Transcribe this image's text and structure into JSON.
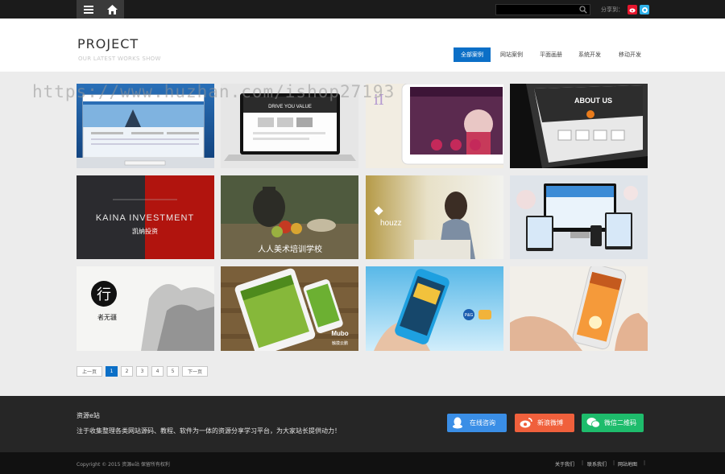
{
  "topbar": {
    "menu_icon": "menu-icon",
    "home_icon": "home-icon",
    "search_value": "",
    "search_icon": "search-icon",
    "share_label": "分享到：",
    "share_weibo_icon": "weibo-icon",
    "share_qzone_icon": "qzone-icon"
  },
  "header": {
    "title": "PROJECT",
    "subtitle": "OUR LATEST WORKS SHOW",
    "nav": [
      "全部案例",
      "网站案例",
      "平面画册",
      "系统开发",
      "移动开发"
    ],
    "active_nav": "全部案例"
  },
  "watermark": "https://www.huzhan.com/ishop27193",
  "gallery": {
    "tiles": [
      {
        "label": "",
        "theme": "blue-website-monitor"
      },
      {
        "label": "DRIVE YOU VALUE",
        "theme": "laptop-mockup"
      },
      {
        "label": "",
        "theme": "purple-tablet"
      },
      {
        "label": "ABOUT US",
        "theme": "dark-tablet"
      },
      {
        "label": "KAINA INVESTMENT",
        "sublabel": "凯纳投资",
        "theme": "red-grey-brand"
      },
      {
        "label": "人人美术培训学校",
        "theme": "still-life-painting"
      },
      {
        "label": "houzz",
        "theme": "woman-reading"
      },
      {
        "label": "",
        "theme": "responsive-devices"
      },
      {
        "label": "行",
        "sublabel": "者无疆",
        "theme": "ink-mountains"
      },
      {
        "label": "Mubo",
        "sublabel": "触摸云鹏",
        "theme": "tablet-phone-wood"
      },
      {
        "label": "P&G",
        "theme": "hand-phone-sky"
      },
      {
        "label": "",
        "theme": "hand-iphone-orange"
      }
    ]
  },
  "pagination": {
    "prev": "上一页",
    "pages": [
      "1",
      "2",
      "3",
      "4",
      "5"
    ],
    "current": "1",
    "next": "下一页"
  },
  "footer": {
    "title": "资源e站",
    "description": "注于收集整理各类网站源码、教程、软件为一体的资源分享学习平台，为大家站长提供动力！",
    "buttons": [
      {
        "label": "在线咨询",
        "color": "#3a8ee6",
        "icon": "qq-icon"
      },
      {
        "label": "新浪微博",
        "color": "#f0603c",
        "icon": "weibo-icon"
      },
      {
        "label": "微信二维码",
        "color": "#1ebc6c",
        "icon": "wechat-icon"
      }
    ]
  },
  "bottom": {
    "copyright": "Copyright © 2015 资源e站 保留所有权利",
    "links": [
      "关于我们",
      "联系我们",
      "网站地图"
    ],
    "separator": "|"
  },
  "colors": {
    "accent": "#0b6fc7",
    "topbar": "#1b1b1b",
    "footer": "#262626",
    "bottom": "#111111",
    "page_bg": "#ececec"
  }
}
